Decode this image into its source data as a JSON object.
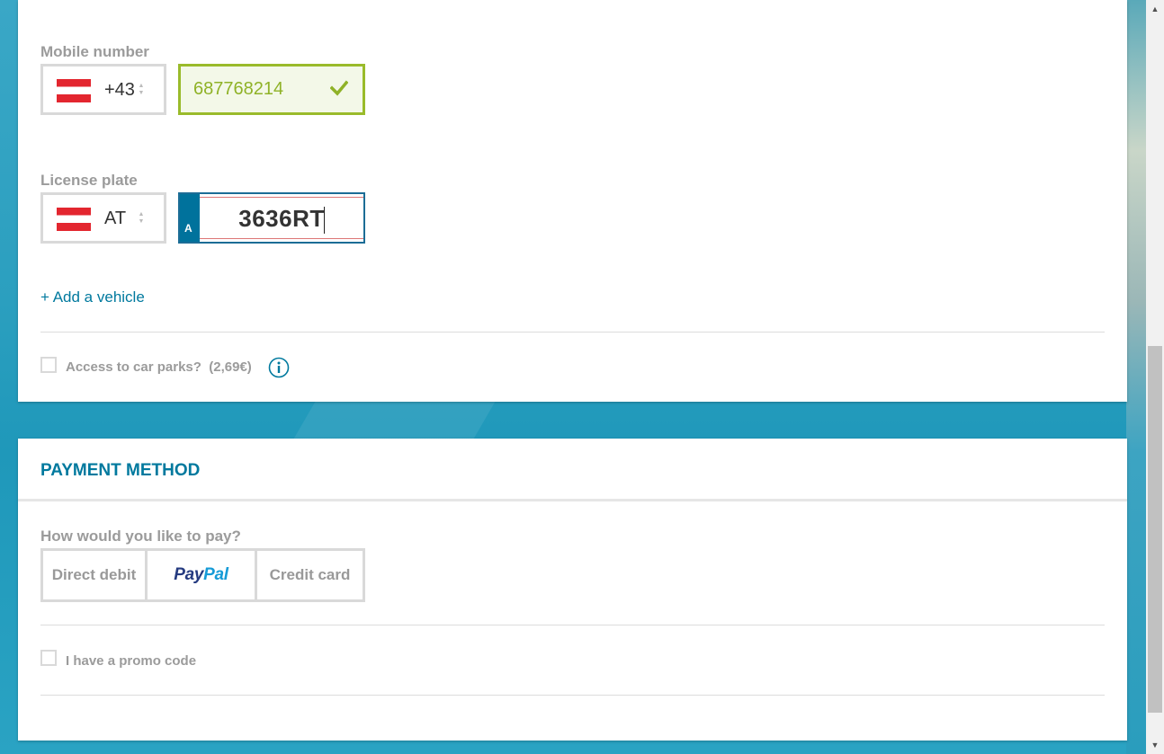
{
  "mobile": {
    "label": "Mobile number",
    "country_code": "+43",
    "number": "687768214",
    "valid_icon": "check-icon"
  },
  "license": {
    "label": "License plate",
    "country": "AT",
    "plate_prefix": "A",
    "plate_value": "3636RT"
  },
  "add_vehicle": "+ Add a vehicle",
  "car_parks": {
    "label": "Access to car parks?",
    "price": "(2,69€)",
    "info_icon": "info-icon"
  },
  "payment": {
    "title": "PAYMENT METHOD",
    "question": "How would you like to pay?",
    "options": {
      "direct_debit": "Direct debit",
      "paypal_part1": "Pay",
      "paypal_part2": "Pal",
      "credit_card": "Credit card"
    },
    "promo_label": "I have a promo code"
  },
  "colors": {
    "accent": "#00799e",
    "valid_green": "#9abb2b",
    "flag_red": "#e3262f"
  }
}
